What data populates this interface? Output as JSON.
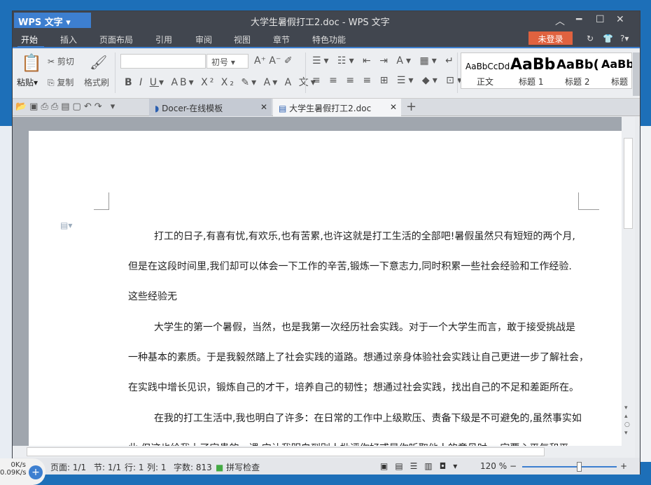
{
  "window": {
    "app_button": "WPS 文字",
    "title": "大学生暑假打工2.doc - WPS 文字"
  },
  "menu": [
    "开始",
    "插入",
    "页面布局",
    "引用",
    "审阅",
    "视图",
    "章节",
    "特色功能"
  ],
  "login": "未登录",
  "ribbon": {
    "paste": "粘贴",
    "cut": "剪切",
    "copy": "复制",
    "format_painter": "格式刷",
    "font_size": "初号",
    "font_name": ""
  },
  "styles": [
    {
      "preview": "AaBbCcDd",
      "label": "正文"
    },
    {
      "preview": "AaBb",
      "label": "标题 1"
    },
    {
      "preview": "AaBb(",
      "label": "标题 2"
    },
    {
      "preview": "AaBb",
      "label": "标题"
    }
  ],
  "tabs": [
    {
      "label": "Docer-在线模板"
    },
    {
      "label": "大学生暑假打工2.doc"
    }
  ],
  "document": {
    "lines": [
      "打工的日子,有喜有忧,有欢乐,也有苦累,也许这就是打工生活的全部吧!暑假虽然只有短短的两个月,",
      "但是在这段时间里,我们却可以体会一下工作的辛苦,锻炼一下意志力,同时积累一些社会经验和工作经验.",
      "这些经验无",
      "大学生的第一个暑假，当然，也是我第一次经历社会实践。对于一个大学生而言，敢于接受挑战是",
      "一种基本的素质。于是我毅然踏上了社会实践的道路。想通过亲身体验社会实践让自己更进一步了解社会，",
      "在实践中增长见识，锻炼自己的才干，培养自己的韧性；想通过社会实践，找出自己的不足和差距所在。",
      "在我的打工生活中,我也明白了许多：在日常的工作中上级欺压、责备下级是不可避免的,虽然事实如",
      "此,但这也给我上了宝贵的一课,它让我明白到别人批评你好或是你听取他人的意见时,一定要心平气和平,"
    ]
  },
  "status": {
    "page": "页面: 1/1",
    "section": "节: 1/1",
    "row": "行: 1",
    "col": "列: 1",
    "words": "字数: 813",
    "spell": "拼写检查",
    "zoom": "120 %",
    "zoom_level": 0.6
  },
  "net": {
    "up": "0K/s",
    "down": "0.09K/s"
  }
}
